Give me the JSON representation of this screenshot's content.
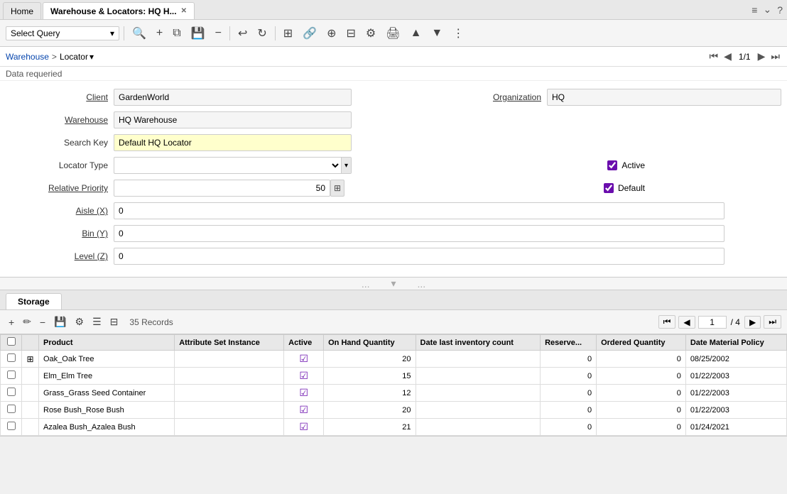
{
  "tabs": {
    "home": {
      "label": "Home",
      "active": false
    },
    "active": {
      "label": "Warehouse & Locators: HQ H...",
      "active": true
    }
  },
  "tabbar_icons": [
    "≡",
    "⌄"
  ],
  "toolbar": {
    "select_query_label": "Select Query",
    "select_query_placeholder": "Select Query",
    "buttons": [
      "🔍",
      "+",
      "⧉",
      "💾",
      "−",
      "↩",
      "↻",
      "⊞",
      "🔗",
      "🔍",
      "⊟",
      "⚙",
      "🖨",
      "▲",
      "▼",
      "⋮"
    ]
  },
  "breadcrumb": {
    "warehouse_link": "Warehouse",
    "separator": ">",
    "locator": "Locator",
    "dropdown_icon": "▾"
  },
  "nav": {
    "first": "⏮",
    "prev": "◀",
    "page_info": "1/1",
    "next": "▶",
    "last": "⏭"
  },
  "status": {
    "text": "Data requeried"
  },
  "form": {
    "client_label": "Client",
    "client_value": "GardenWorld",
    "organization_label": "Organization",
    "organization_value": "HQ",
    "warehouse_label": "Warehouse",
    "warehouse_value": "HQ Warehouse",
    "search_key_label": "Search Key",
    "search_key_value": "Default HQ Locator",
    "locator_type_label": "Locator Type",
    "locator_type_value": "",
    "active_label": "Active",
    "active_checked": true,
    "relative_priority_label": "Relative Priority",
    "relative_priority_value": "50",
    "default_label": "Default",
    "default_checked": true,
    "aisle_label": "Aisle (X)",
    "aisle_value": "0",
    "bin_label": "Bin (Y)",
    "bin_value": "0",
    "level_label": "Level (Z)",
    "level_value": "0"
  },
  "storage": {
    "tab_label": "Storage",
    "record_count": "35 Records",
    "page_current": "1",
    "page_total": "/ 4",
    "columns": [
      "Product",
      "Attribute Set Instance",
      "Active",
      "On Hand Quantity",
      "Date last inventory count",
      "Reserve...",
      "Ordered Quantity",
      "Date Material Policy"
    ],
    "rows": [
      {
        "product": "Oak_Oak Tree",
        "attr": "",
        "active": true,
        "on_hand": 20,
        "date_inv": "",
        "reserve": 0,
        "ordered": 0,
        "date_mat": "08/25/2002",
        "icon": true
      },
      {
        "product": "Elm_Elm Tree",
        "attr": "",
        "active": true,
        "on_hand": 15,
        "date_inv": "",
        "reserve": 0,
        "ordered": 0,
        "date_mat": "01/22/2003",
        "icon": false
      },
      {
        "product": "Grass_Grass Seed Container",
        "attr": "",
        "active": true,
        "on_hand": 12,
        "date_inv": "",
        "reserve": 0,
        "ordered": 0,
        "date_mat": "01/22/2003",
        "icon": false
      },
      {
        "product": "Rose Bush_Rose Bush",
        "attr": "",
        "active": true,
        "on_hand": 20,
        "date_inv": "",
        "reserve": 0,
        "ordered": 0,
        "date_mat": "01/22/2003",
        "icon": false
      },
      {
        "product": "Azalea Bush_Azalea Bush",
        "attr": "",
        "active": true,
        "on_hand": 21,
        "date_inv": "",
        "reserve": 0,
        "ordered": 0,
        "date_mat": "01/24/2021",
        "icon": false
      }
    ]
  }
}
